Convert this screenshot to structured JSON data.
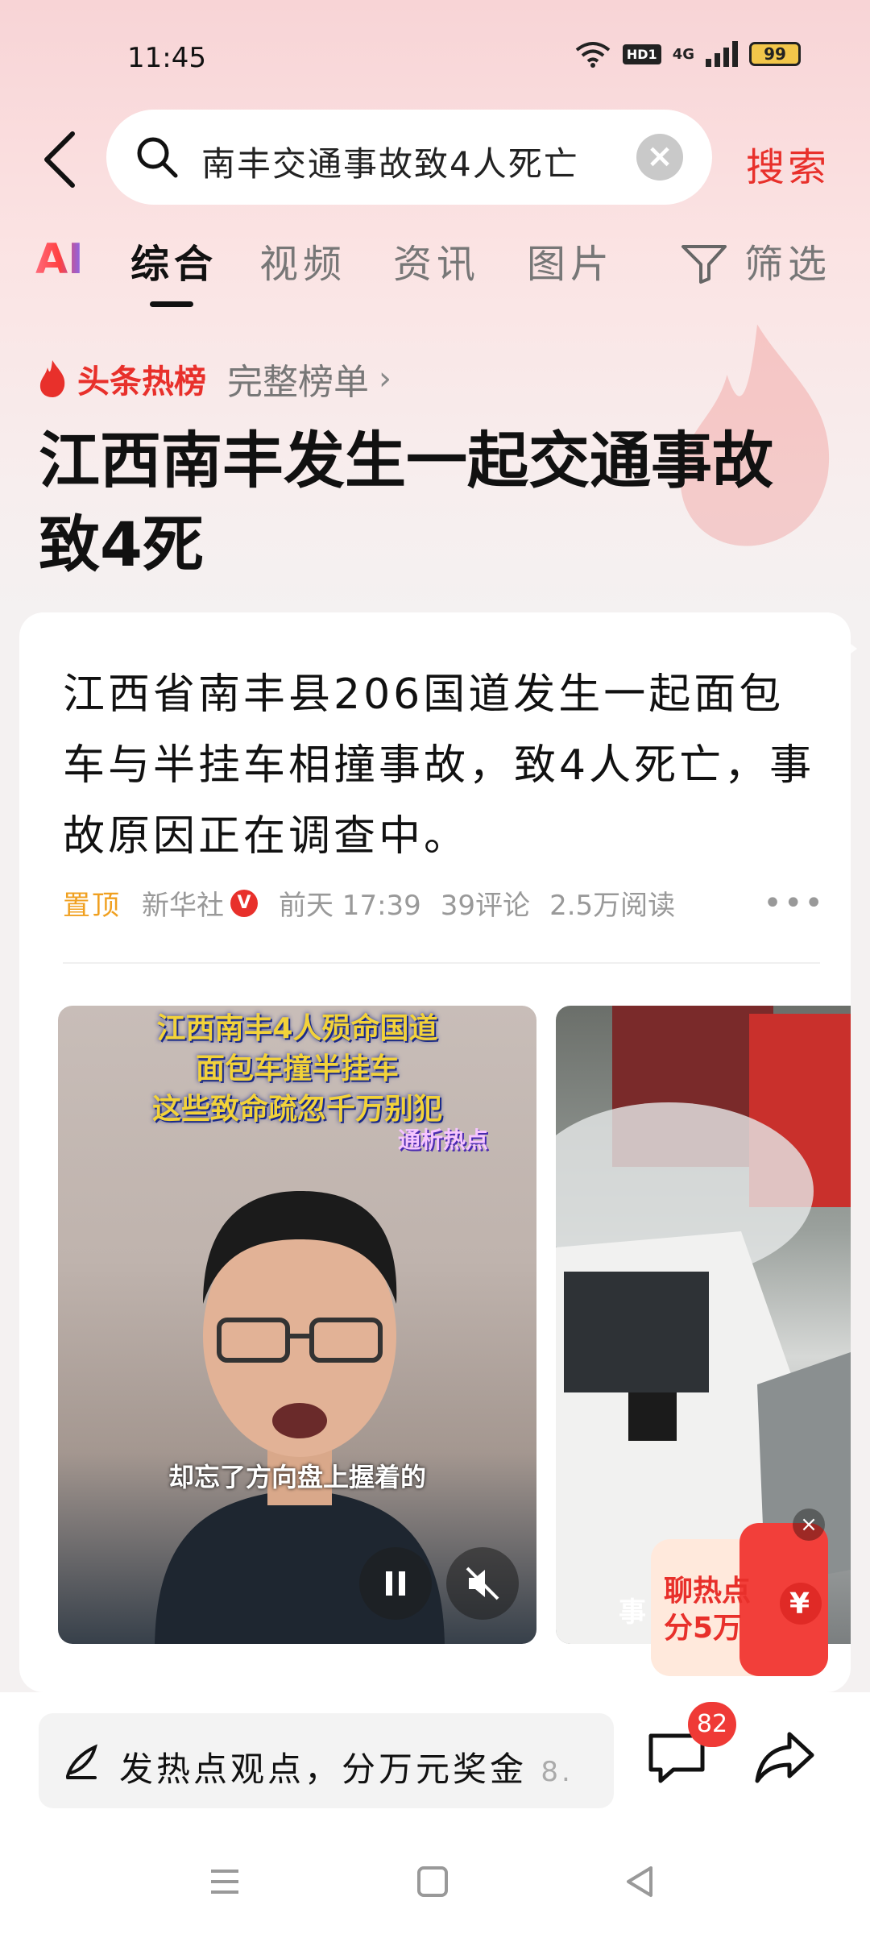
{
  "status_bar": {
    "time": "11:45",
    "hd": "HD1",
    "net": "4G",
    "battery": "99"
  },
  "search": {
    "query": "南丰交通事故致4人死亡",
    "button_label": "搜索"
  },
  "tabs": {
    "ai": "AI",
    "items": [
      "综合",
      "视频",
      "资讯",
      "图片"
    ],
    "filter": "筛选"
  },
  "hot": {
    "label": "头条热榜",
    "full_list": "完整榜单",
    "headline": "江西南丰发生一起交通事故致4死"
  },
  "card": {
    "summary": "江西省南丰县206国道发生一起面包车与半挂车相撞事故，致4人死亡，事故原因正在调查中。",
    "meta": {
      "pinned": "置顶",
      "source": "新华社",
      "verified": "V",
      "time": "前天 17:39",
      "comments": "39评论",
      "reads": "2.5万阅读"
    },
    "videos": [
      {
        "title_lines": [
          "江西南丰4人殒命国道",
          "面包车撞半挂车",
          "这些致命疏忽千万别犯"
        ],
        "tag": "通析热点",
        "caption": "却忘了方向盘上握着的"
      },
      {
        "label": "事"
      }
    ],
    "promo": {
      "line1": "聊热点",
      "line2": "分5万",
      "symbol": "¥"
    }
  },
  "bottom": {
    "comment_placeholder": "发热点观点，分万元奖金",
    "comment_suffix": "8.",
    "comment_count": "82"
  },
  "colors": {
    "accent_red": "#e8302b",
    "pin_orange": "#f0a020"
  }
}
